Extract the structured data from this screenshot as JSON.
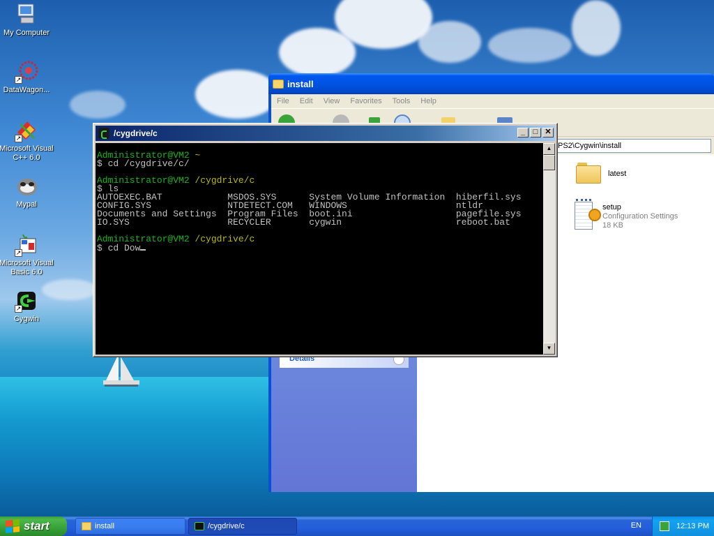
{
  "desktop": {
    "icons": [
      {
        "label": "My Computer",
        "icon": "my-computer-icon"
      },
      {
        "label": "DataWagon...",
        "icon": "datawagon-icon"
      },
      {
        "label": "Microsoft Visual C++ 6.0",
        "icon": "visual-cpp-icon"
      },
      {
        "label": "Mypal",
        "icon": "mypal-browser-icon"
      },
      {
        "label": "Microsoft Visual Basic 6.0",
        "icon": "visual-basic-icon"
      },
      {
        "label": "Cygwin",
        "icon": "cygwin-icon"
      }
    ]
  },
  "explorer": {
    "title": "install",
    "menu": [
      "File",
      "Edit",
      "View",
      "Favorites",
      "Tools",
      "Help"
    ],
    "address": "PS2\\Cygwin\\install",
    "details_label": "Details",
    "files": [
      {
        "name": "latest",
        "sub1": "",
        "sub2": "",
        "icon": "folder-icon"
      },
      {
        "name": "setup",
        "sub1": "Configuration Settings",
        "sub2": "18 KB",
        "icon": "config-file-icon"
      }
    ]
  },
  "terminal": {
    "title": "/cygdrive/c",
    "lines": [
      {
        "user": "Administrator@VM2",
        "path": " ~",
        "text": ""
      },
      {
        "user": "",
        "path": "",
        "text": "$ cd /cygdrive/c/"
      },
      {
        "user": "",
        "path": "",
        "text": ""
      },
      {
        "user": "Administrator@VM2",
        "path": " /cygdrive/c",
        "text": ""
      },
      {
        "user": "",
        "path": "",
        "text": "$ ls"
      },
      {
        "user": "",
        "path": "",
        "text": "AUTOEXEC.BAT            MSDOS.SYS      System Volume Information  hiberfil.sys"
      },
      {
        "user": "",
        "path": "",
        "text": "CONFIG.SYS              NTDETECT.COM   WINDOWS                    ntldr"
      },
      {
        "user": "",
        "path": "",
        "text": "Documents and Settings  Program Files  boot.ini                   pagefile.sys"
      },
      {
        "user": "",
        "path": "",
        "text": "IO.SYS                  RECYCLER       cygwin                     reboot.bat"
      },
      {
        "user": "",
        "path": "",
        "text": ""
      },
      {
        "user": "Administrator@VM2",
        "path": " /cygdrive/c",
        "text": ""
      },
      {
        "user": "",
        "path": "",
        "text": "$ cd Dow"
      }
    ]
  },
  "taskbar": {
    "start_label": "start",
    "tasks": [
      {
        "label": "install",
        "active": false
      },
      {
        "label": "/cygdrive/c",
        "active": true
      }
    ],
    "language": "EN",
    "clock": "12:13 PM"
  },
  "colors": {
    "prompt_user": "#16b516",
    "prompt_path": "#b8b800",
    "xp_blue": "#0054e3",
    "start_green": "#37a037"
  }
}
